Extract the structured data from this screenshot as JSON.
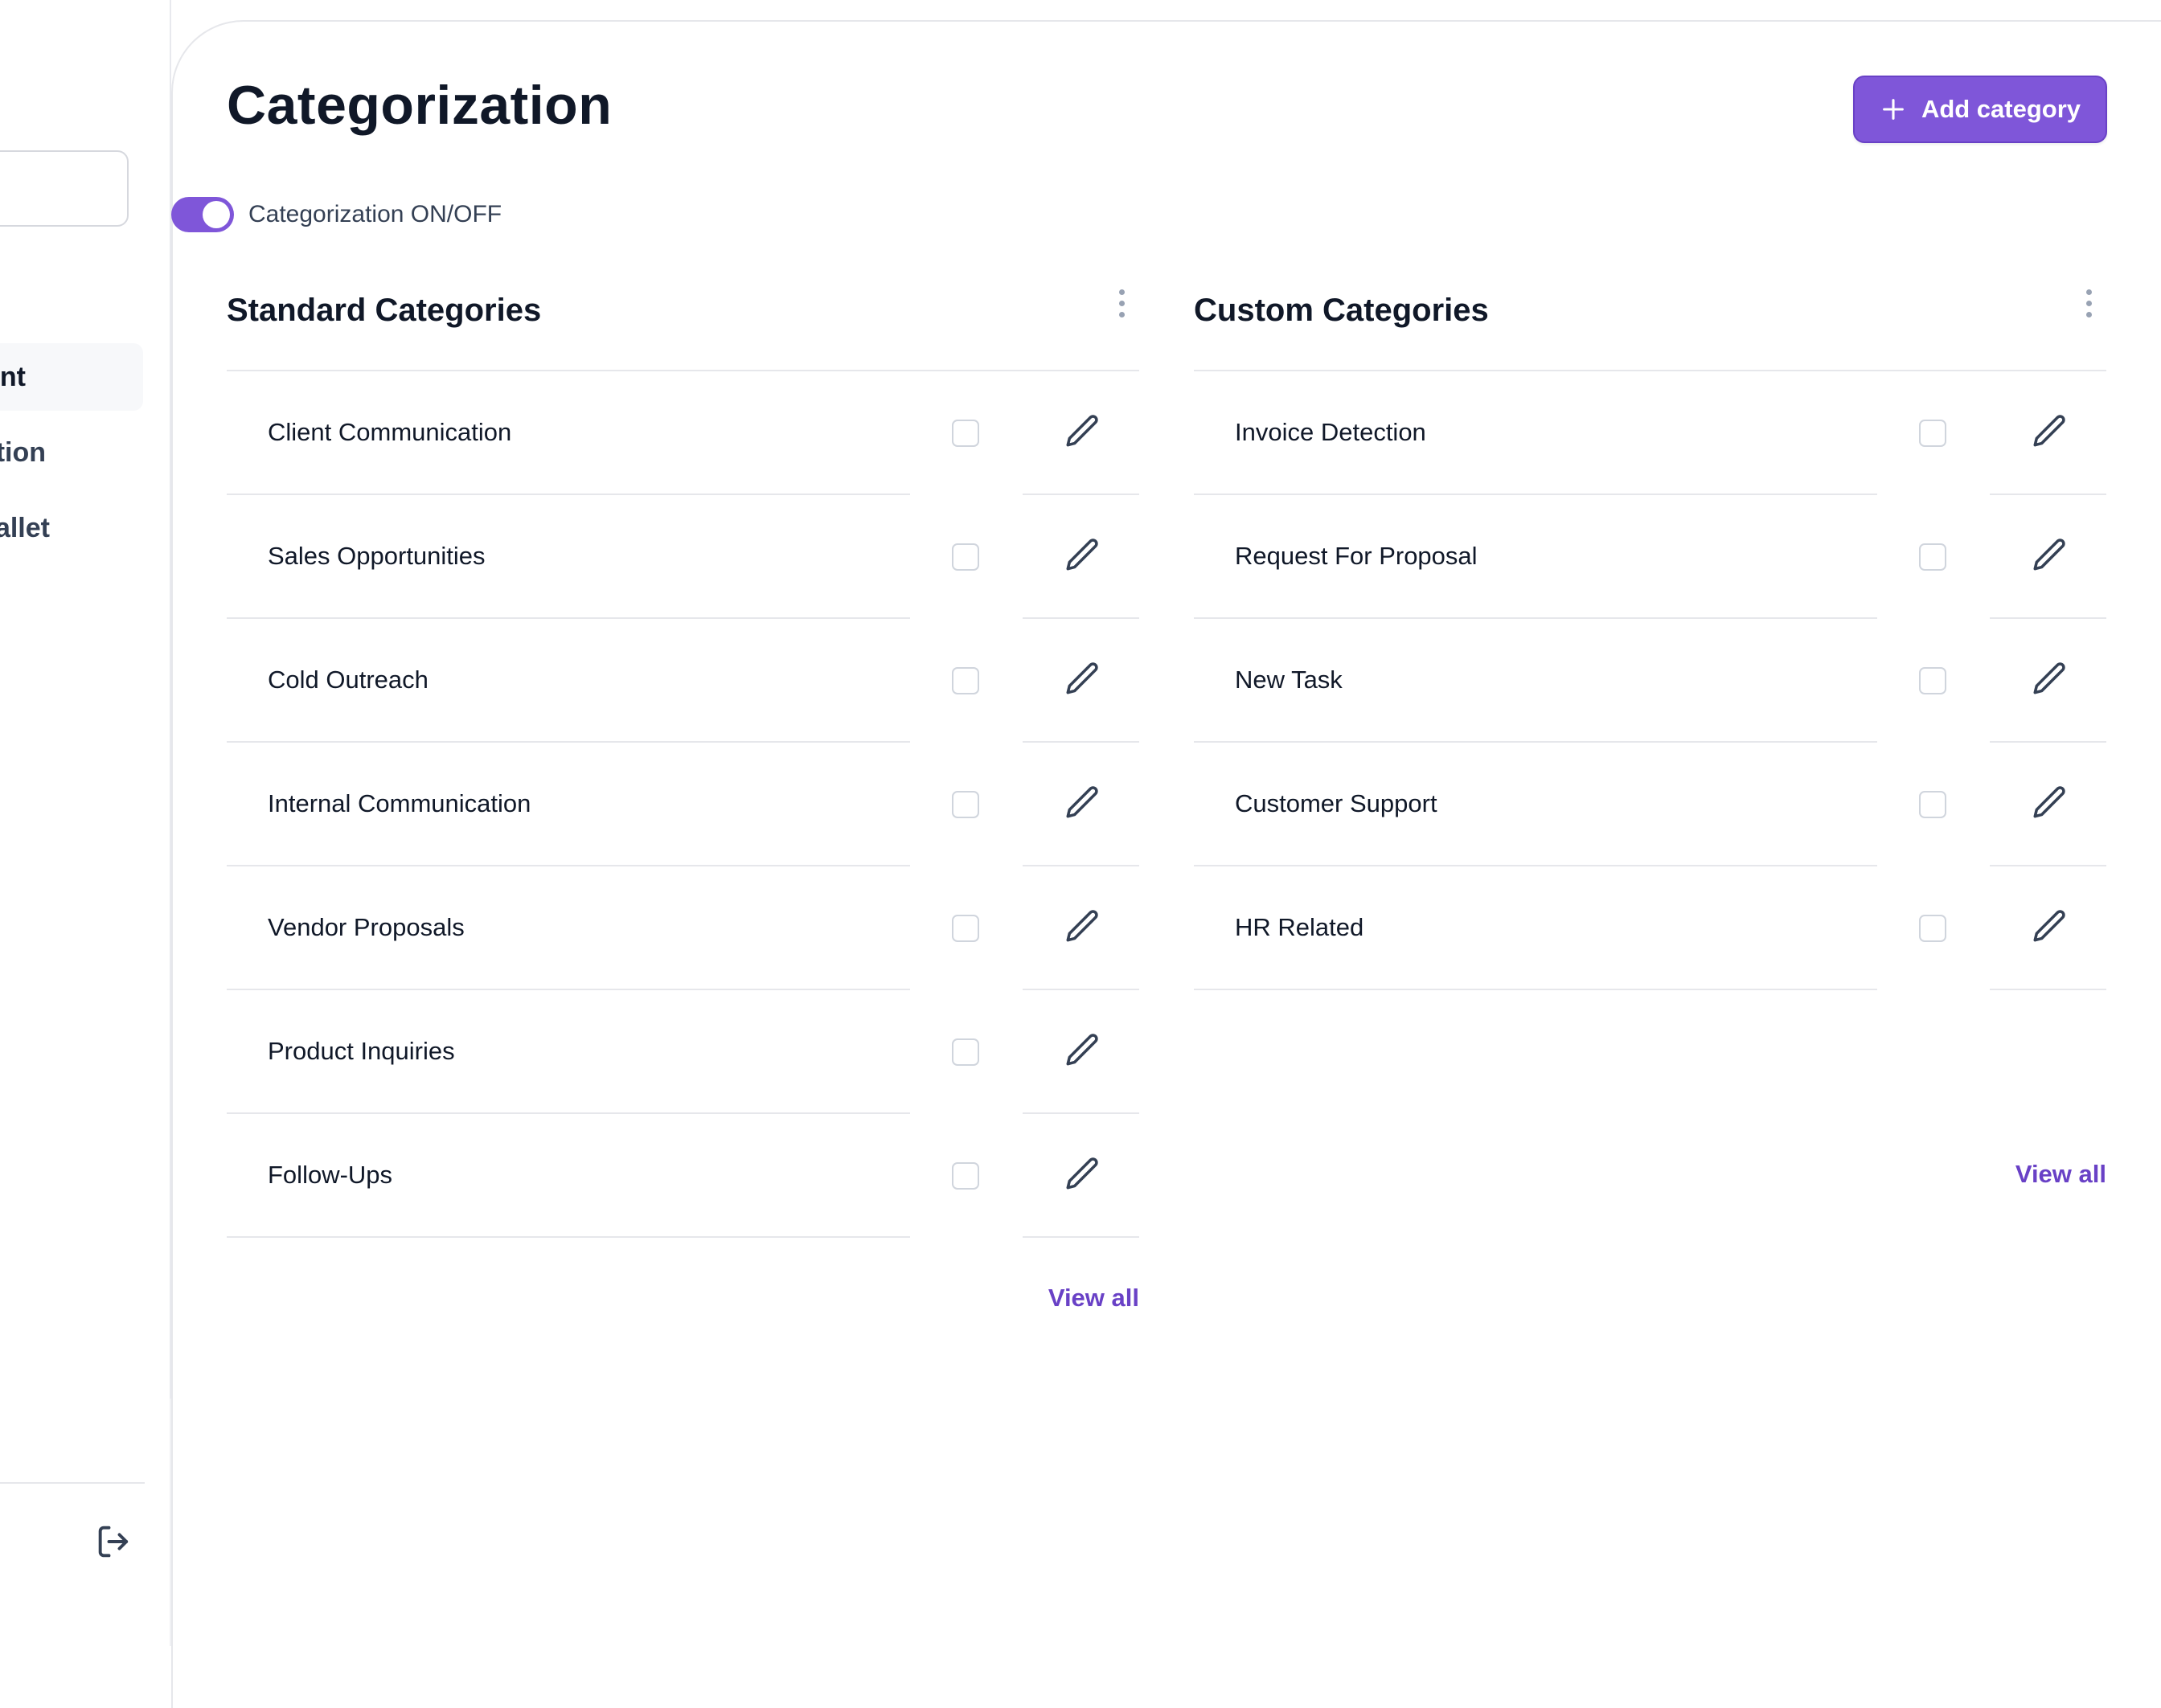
{
  "sidebar": {
    "items": [
      {
        "label": "nent",
        "active": true
      },
      {
        "label": "zation",
        "active": false
      },
      {
        "label": "Wallet",
        "active": false
      }
    ],
    "logout_icon": "logout-icon"
  },
  "header": {
    "title": "Categorization",
    "add_button_label": "Add category",
    "add_button_icon": "plus-icon"
  },
  "toggle": {
    "label": "Categorization ON/OFF",
    "on": true
  },
  "standard": {
    "title": "Standard Categories",
    "items": [
      {
        "label": "Client Communication",
        "checked": false
      },
      {
        "label": "Sales Opportunities",
        "checked": false
      },
      {
        "label": "Cold Outreach",
        "checked": false
      },
      {
        "label": "Internal Communication",
        "checked": false
      },
      {
        "label": "Vendor Proposals",
        "checked": false
      },
      {
        "label": "Product Inquiries",
        "checked": false
      },
      {
        "label": "Follow-Ups",
        "checked": false
      }
    ],
    "view_all": "View all"
  },
  "custom": {
    "title": "Custom Categories",
    "items": [
      {
        "label": "Invoice Detection",
        "checked": false
      },
      {
        "label": "Request For Proposal",
        "checked": false
      },
      {
        "label": "New Task",
        "checked": false
      },
      {
        "label": "Customer Support",
        "checked": false
      },
      {
        "label": "HR Related",
        "checked": false
      }
    ],
    "view_all": "View all"
  },
  "colors": {
    "accent": "#7f56d9",
    "accent_dark": "#6941c6",
    "text": "#101828",
    "muted": "#344054",
    "border": "#e6e7eb"
  }
}
